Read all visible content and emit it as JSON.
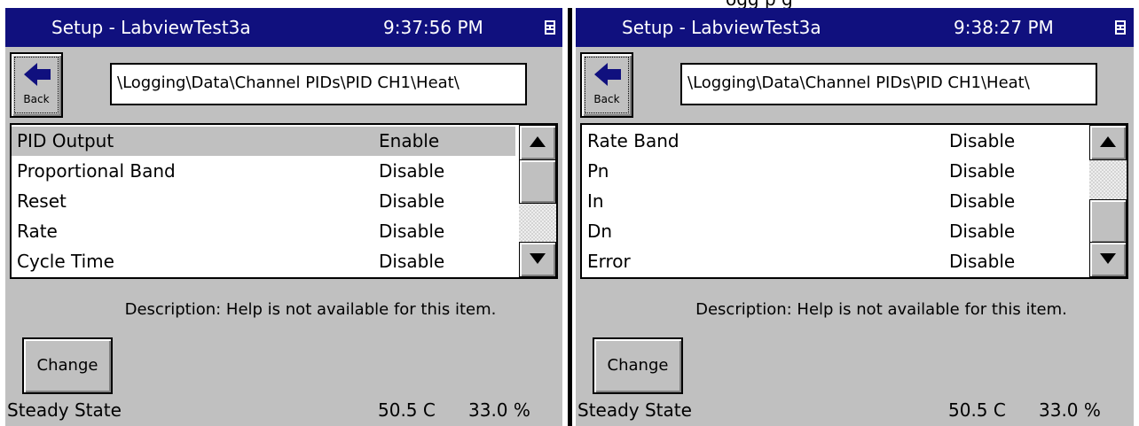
{
  "top_partial_text": "ogg        p        g",
  "accent_colors": {
    "titlebar": "#10107e",
    "face": "#c0c0c0",
    "selection": "#c0c0c0"
  },
  "screens": [
    {
      "title": "Setup - LabviewTest3a",
      "clock": "9:37:56 PM",
      "tray_icon": "keyboard-icon",
      "back_label": "Back",
      "back_icon": "left-arrow-icon",
      "path": "\\Logging\\Data\\Channel PIDs\\PID CH1\\Heat\\",
      "rows": [
        {
          "name": "PID Output",
          "value": "Enable",
          "selected": true
        },
        {
          "name": "Proportional Band",
          "value": "Disable"
        },
        {
          "name": "Reset",
          "value": "Disable"
        },
        {
          "name": "Rate",
          "value": "Disable"
        },
        {
          "name": "Cycle Time",
          "value": "Disable"
        }
      ],
      "scroll_position": 0.0,
      "description": "Description:  Help is not available for this item.",
      "change_label": "Change",
      "status": {
        "state": "Steady State",
        "temperature": "50.5 C",
        "output": "33.0 %"
      }
    },
    {
      "title": "Setup - LabviewTest3a",
      "clock": "9:38:27 PM",
      "tray_icon": "keyboard-icon",
      "back_label": "Back",
      "back_icon": "left-arrow-icon",
      "path": "\\Logging\\Data\\Channel PIDs\\PID CH1\\Heat\\",
      "rows": [
        {
          "name": "Rate Band",
          "value": "Disable"
        },
        {
          "name": "Pn",
          "value": "Disable"
        },
        {
          "name": "In",
          "value": "Disable"
        },
        {
          "name": "Dn",
          "value": "Disable"
        },
        {
          "name": "Error",
          "value": "Disable"
        }
      ],
      "scroll_position": 1.0,
      "description": "Description:  Help is not available for this item.",
      "change_label": "Change",
      "status": {
        "state": "Steady State",
        "temperature": "50.5 C",
        "output": "33.0 %"
      }
    }
  ]
}
